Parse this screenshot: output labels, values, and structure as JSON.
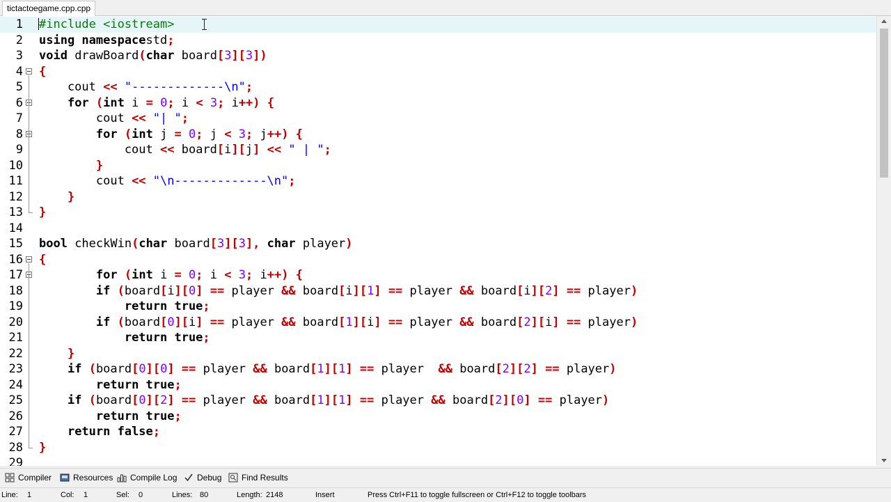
{
  "tab": {
    "label": "tictactoegame.cpp.cpp"
  },
  "editor": {
    "lines": [
      {
        "n": "1",
        "fold": "",
        "tokens": [
          [
            "pp",
            "#include <iostream>"
          ]
        ]
      },
      {
        "n": "2",
        "fold": "",
        "tokens": [
          [
            "kw",
            "using namespace"
          ],
          [
            "",
            "std"
          ],
          [
            "sy",
            ";"
          ]
        ]
      },
      {
        "n": "3",
        "fold": "",
        "tokens": [
          [
            "kw",
            "void"
          ],
          [
            "",
            " drawBoard"
          ],
          [
            "sy",
            "("
          ],
          [
            "kw",
            "char"
          ],
          [
            "",
            " board"
          ],
          [
            "sy",
            "["
          ],
          [
            "nm",
            "3"
          ],
          [
            "sy",
            "]["
          ],
          [
            "nm",
            "3"
          ],
          [
            "sy",
            "])"
          ]
        ]
      },
      {
        "n": "4",
        "fold": "open",
        "tokens": [
          [
            "sy",
            "{"
          ]
        ]
      },
      {
        "n": "5",
        "fold": "",
        "tokens": [
          [
            "",
            "    cout "
          ],
          [
            "sy",
            "<<"
          ],
          [
            "",
            " "
          ],
          [
            "st",
            "\"-------------\\n\""
          ],
          [
            "sy",
            ";"
          ]
        ]
      },
      {
        "n": "6",
        "fold": "open",
        "tokens": [
          [
            "",
            "    "
          ],
          [
            "kw",
            "for"
          ],
          [
            "",
            " "
          ],
          [
            "sy",
            "("
          ],
          [
            "kw",
            "int"
          ],
          [
            "",
            " i "
          ],
          [
            "sy",
            "="
          ],
          [
            "",
            " "
          ],
          [
            "nm",
            "0"
          ],
          [
            "sy",
            ";"
          ],
          [
            "",
            " i "
          ],
          [
            "sy",
            "<"
          ],
          [
            "",
            " "
          ],
          [
            "nm",
            "3"
          ],
          [
            "sy",
            ";"
          ],
          [
            "",
            " i"
          ],
          [
            "sy",
            "++)"
          ],
          [
            "",
            " "
          ],
          [
            "sy",
            "{"
          ]
        ]
      },
      {
        "n": "7",
        "fold": "",
        "tokens": [
          [
            "",
            "        cout "
          ],
          [
            "sy",
            "<<"
          ],
          [
            "",
            " "
          ],
          [
            "st",
            "\"| \""
          ],
          [
            "sy",
            ";"
          ]
        ]
      },
      {
        "n": "8",
        "fold": "open",
        "tokens": [
          [
            "",
            "        "
          ],
          [
            "kw",
            "for"
          ],
          [
            "",
            " "
          ],
          [
            "sy",
            "("
          ],
          [
            "kw",
            "int"
          ],
          [
            "",
            " j "
          ],
          [
            "sy",
            "="
          ],
          [
            "",
            " "
          ],
          [
            "nm",
            "0"
          ],
          [
            "sy",
            ";"
          ],
          [
            "",
            " j "
          ],
          [
            "sy",
            "<"
          ],
          [
            "",
            " "
          ],
          [
            "nm",
            "3"
          ],
          [
            "sy",
            ";"
          ],
          [
            "",
            " j"
          ],
          [
            "sy",
            "++)"
          ],
          [
            "",
            " "
          ],
          [
            "sy",
            "{"
          ]
        ]
      },
      {
        "n": "9",
        "fold": "",
        "tokens": [
          [
            "",
            "            cout "
          ],
          [
            "sy",
            "<<"
          ],
          [
            "",
            " board"
          ],
          [
            "sy",
            "["
          ],
          [
            "",
            "i"
          ],
          [
            "sy",
            "]["
          ],
          [
            "",
            "j"
          ],
          [
            "sy",
            "]"
          ],
          [
            "",
            " "
          ],
          [
            "sy",
            "<<"
          ],
          [
            "",
            " "
          ],
          [
            "st",
            "\" | \""
          ],
          [
            "sy",
            ";"
          ]
        ]
      },
      {
        "n": "10",
        "fold": "",
        "tokens": [
          [
            "",
            "        "
          ],
          [
            "sy",
            "}"
          ]
        ]
      },
      {
        "n": "11",
        "fold": "",
        "tokens": [
          [
            "",
            "        cout "
          ],
          [
            "sy",
            "<<"
          ],
          [
            "",
            " "
          ],
          [
            "st",
            "\"\\n-------------\\n\""
          ],
          [
            "sy",
            ";"
          ]
        ]
      },
      {
        "n": "12",
        "fold": "",
        "tokens": [
          [
            "",
            "    "
          ],
          [
            "sy",
            "}"
          ]
        ]
      },
      {
        "n": "13",
        "fold": "end",
        "tokens": [
          [
            "sy",
            "}"
          ]
        ]
      },
      {
        "n": "14",
        "fold": "",
        "tokens": []
      },
      {
        "n": "15",
        "fold": "",
        "tokens": [
          [
            "kw",
            "bool"
          ],
          [
            "",
            " checkWin"
          ],
          [
            "sy",
            "("
          ],
          [
            "kw",
            "char"
          ],
          [
            "",
            " board"
          ],
          [
            "sy",
            "["
          ],
          [
            "nm",
            "3"
          ],
          [
            "sy",
            "]["
          ],
          [
            "nm",
            "3"
          ],
          [
            "sy",
            "],"
          ],
          [
            "",
            " "
          ],
          [
            "kw",
            "char"
          ],
          [
            "",
            " player"
          ],
          [
            "sy",
            ")"
          ]
        ]
      },
      {
        "n": "16",
        "fold": "open",
        "tokens": [
          [
            "sy",
            "{"
          ]
        ]
      },
      {
        "n": "17",
        "fold": "open",
        "tokens": [
          [
            "",
            "        "
          ],
          [
            "kw",
            "for"
          ],
          [
            "",
            " "
          ],
          [
            "sy",
            "("
          ],
          [
            "kw",
            "int"
          ],
          [
            "",
            " i "
          ],
          [
            "sy",
            "="
          ],
          [
            "",
            " "
          ],
          [
            "nm",
            "0"
          ],
          [
            "sy",
            ";"
          ],
          [
            "",
            " i "
          ],
          [
            "sy",
            "<"
          ],
          [
            "",
            " "
          ],
          [
            "nm",
            "3"
          ],
          [
            "sy",
            ";"
          ],
          [
            "",
            " i"
          ],
          [
            "sy",
            "++)"
          ],
          [
            "",
            " "
          ],
          [
            "sy",
            "{"
          ]
        ]
      },
      {
        "n": "18",
        "fold": "",
        "tokens": [
          [
            "",
            "        "
          ],
          [
            "kw",
            "if"
          ],
          [
            "",
            " "
          ],
          [
            "sy",
            "("
          ],
          [
            "",
            "board"
          ],
          [
            "sy",
            "["
          ],
          [
            "",
            "i"
          ],
          [
            "sy",
            "]["
          ],
          [
            "nm",
            "0"
          ],
          [
            "sy",
            "]"
          ],
          [
            "",
            " "
          ],
          [
            "sy",
            "=="
          ],
          [
            "",
            " player "
          ],
          [
            "sy",
            "&&"
          ],
          [
            "",
            " board"
          ],
          [
            "sy",
            "["
          ],
          [
            "",
            "i"
          ],
          [
            "sy",
            "]["
          ],
          [
            "nm",
            "1"
          ],
          [
            "sy",
            "]"
          ],
          [
            "",
            " "
          ],
          [
            "sy",
            "=="
          ],
          [
            "",
            " player "
          ],
          [
            "sy",
            "&&"
          ],
          [
            "",
            " board"
          ],
          [
            "sy",
            "["
          ],
          [
            "",
            "i"
          ],
          [
            "sy",
            "]["
          ],
          [
            "nm",
            "2"
          ],
          [
            "sy",
            "]"
          ],
          [
            "",
            " "
          ],
          [
            "sy",
            "=="
          ],
          [
            "",
            " player"
          ],
          [
            "sy",
            ")"
          ]
        ]
      },
      {
        "n": "19",
        "fold": "",
        "tokens": [
          [
            "",
            "            "
          ],
          [
            "kw",
            "return true"
          ],
          [
            "sy",
            ";"
          ]
        ]
      },
      {
        "n": "20",
        "fold": "",
        "tokens": [
          [
            "",
            "        "
          ],
          [
            "kw",
            "if"
          ],
          [
            "",
            " "
          ],
          [
            "sy",
            "("
          ],
          [
            "",
            "board"
          ],
          [
            "sy",
            "["
          ],
          [
            "nm",
            "0"
          ],
          [
            "sy",
            "]["
          ],
          [
            "",
            "i"
          ],
          [
            "sy",
            "]"
          ],
          [
            "",
            " "
          ],
          [
            "sy",
            "=="
          ],
          [
            "",
            " player "
          ],
          [
            "sy",
            "&&"
          ],
          [
            "",
            " board"
          ],
          [
            "sy",
            "["
          ],
          [
            "nm",
            "1"
          ],
          [
            "sy",
            "]["
          ],
          [
            "",
            "i"
          ],
          [
            "sy",
            "]"
          ],
          [
            "",
            " "
          ],
          [
            "sy",
            "=="
          ],
          [
            "",
            " player "
          ],
          [
            "sy",
            "&&"
          ],
          [
            "",
            " board"
          ],
          [
            "sy",
            "["
          ],
          [
            "nm",
            "2"
          ],
          [
            "sy",
            "]["
          ],
          [
            "",
            "i"
          ],
          [
            "sy",
            "]"
          ],
          [
            "",
            " "
          ],
          [
            "sy",
            "=="
          ],
          [
            "",
            " player"
          ],
          [
            "sy",
            ")"
          ]
        ]
      },
      {
        "n": "21",
        "fold": "",
        "tokens": [
          [
            "",
            "            "
          ],
          [
            "kw",
            "return true"
          ],
          [
            "sy",
            ";"
          ]
        ]
      },
      {
        "n": "22",
        "fold": "",
        "tokens": [
          [
            "",
            "    "
          ],
          [
            "sy",
            "}"
          ]
        ]
      },
      {
        "n": "23",
        "fold": "",
        "tokens": [
          [
            "",
            "    "
          ],
          [
            "kw",
            "if"
          ],
          [
            "",
            " "
          ],
          [
            "sy",
            "("
          ],
          [
            "",
            "board"
          ],
          [
            "sy",
            "["
          ],
          [
            "nm",
            "0"
          ],
          [
            "sy",
            "]["
          ],
          [
            "nm",
            "0"
          ],
          [
            "sy",
            "]"
          ],
          [
            "",
            " "
          ],
          [
            "sy",
            "=="
          ],
          [
            "",
            " player "
          ],
          [
            "sy",
            "&&"
          ],
          [
            "",
            " board"
          ],
          [
            "sy",
            "["
          ],
          [
            "nm",
            "1"
          ],
          [
            "sy",
            "]["
          ],
          [
            "nm",
            "1"
          ],
          [
            "sy",
            "]"
          ],
          [
            "",
            " "
          ],
          [
            "sy",
            "=="
          ],
          [
            "",
            " player  "
          ],
          [
            "sy",
            "&&"
          ],
          [
            "",
            " board"
          ],
          [
            "sy",
            "["
          ],
          [
            "nm",
            "2"
          ],
          [
            "sy",
            "]["
          ],
          [
            "nm",
            "2"
          ],
          [
            "sy",
            "]"
          ],
          [
            "",
            " "
          ],
          [
            "sy",
            "=="
          ],
          [
            "",
            " player"
          ],
          [
            "sy",
            ")"
          ]
        ]
      },
      {
        "n": "24",
        "fold": "",
        "tokens": [
          [
            "",
            "        "
          ],
          [
            "kw",
            "return true"
          ],
          [
            "sy",
            ";"
          ]
        ]
      },
      {
        "n": "25",
        "fold": "",
        "tokens": [
          [
            "",
            "    "
          ],
          [
            "kw",
            "if"
          ],
          [
            "",
            " "
          ],
          [
            "sy",
            "("
          ],
          [
            "",
            "board"
          ],
          [
            "sy",
            "["
          ],
          [
            "nm",
            "0"
          ],
          [
            "sy",
            "]["
          ],
          [
            "nm",
            "2"
          ],
          [
            "sy",
            "]"
          ],
          [
            "",
            " "
          ],
          [
            "sy",
            "=="
          ],
          [
            "",
            " player "
          ],
          [
            "sy",
            "&&"
          ],
          [
            "",
            " board"
          ],
          [
            "sy",
            "["
          ],
          [
            "nm",
            "1"
          ],
          [
            "sy",
            "]["
          ],
          [
            "nm",
            "1"
          ],
          [
            "sy",
            "]"
          ],
          [
            "",
            " "
          ],
          [
            "sy",
            "=="
          ],
          [
            "",
            " player "
          ],
          [
            "sy",
            "&&"
          ],
          [
            "",
            " board"
          ],
          [
            "sy",
            "["
          ],
          [
            "nm",
            "2"
          ],
          [
            "sy",
            "]["
          ],
          [
            "nm",
            "0"
          ],
          [
            "sy",
            "]"
          ],
          [
            "",
            " "
          ],
          [
            "sy",
            "=="
          ],
          [
            "",
            " player"
          ],
          [
            "sy",
            ")"
          ]
        ]
      },
      {
        "n": "26",
        "fold": "",
        "tokens": [
          [
            "",
            "        "
          ],
          [
            "kw",
            "return true"
          ],
          [
            "sy",
            ";"
          ]
        ]
      },
      {
        "n": "27",
        "fold": "",
        "tokens": [
          [
            "",
            "    "
          ],
          [
            "kw",
            "return false"
          ],
          [
            "sy",
            ";"
          ]
        ]
      },
      {
        "n": "28",
        "fold": "end",
        "tokens": [
          [
            "sy",
            "}"
          ]
        ]
      },
      {
        "n": "29",
        "fold": "",
        "tokens": []
      }
    ]
  },
  "toolbar": {
    "compiler": "Compiler",
    "resources": "Resources",
    "compile_log": "Compile Log",
    "debug": "Debug",
    "find_results": "Find Results"
  },
  "status": {
    "line_label": "Line:",
    "line_value": "1",
    "col_label": "Col:",
    "col_value": "1",
    "sel_label": "Sel:",
    "sel_value": "0",
    "lines_label": "Lines:",
    "lines_value": "80",
    "length_label": "Length:",
    "length_value": "2148",
    "mode": "Insert",
    "hint": "Press Ctrl+F11 to toggle fullscreen or Ctrl+F12 to toggle toolbars"
  }
}
